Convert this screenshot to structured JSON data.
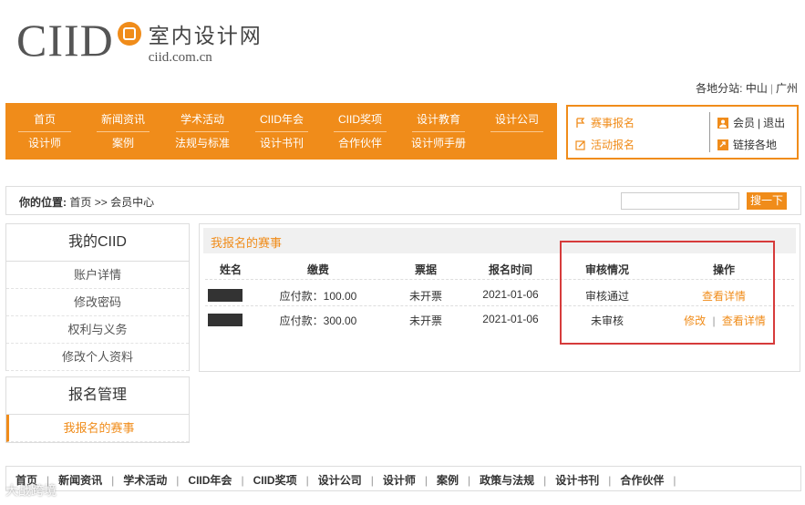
{
  "logo": {
    "brand": "CIID",
    "cn": "室内设计网",
    "en": "ciid.com.cn"
  },
  "branches": {
    "label": "各地分站:",
    "items": [
      "中山",
      "广州"
    ]
  },
  "nav": {
    "row1": [
      "首页",
      "新闻资讯",
      "学术活动",
      "CIID年会",
      "CIID奖项",
      "设计教育",
      "设计公司"
    ],
    "row2": [
      "设计师",
      "案例",
      "法规与标准",
      "设计书刊",
      "合作伙伴",
      "设计师手册"
    ]
  },
  "side_links": {
    "competition": "赛事报名",
    "activity": "活动报名",
    "member": "会员",
    "logout": "退出",
    "branches": "链接各地"
  },
  "location": {
    "label": "你的位置:",
    "home": "首页",
    "sep": ">>",
    "current": "会员中心"
  },
  "search": {
    "button": "搜一下",
    "value": ""
  },
  "sidebar": {
    "my_ciid": "我的CIID",
    "items": [
      "账户详情",
      "修改密码",
      "权利与义务",
      "修改个人资料"
    ],
    "reg_title": "报名管理",
    "reg_items": [
      "我报名的赛事"
    ]
  },
  "main": {
    "title": "我报名的赛事",
    "columns": [
      "姓名",
      "缴费",
      "票据",
      "报名时间",
      "审核情况",
      "操作"
    ],
    "rows": [
      {
        "fee": "应付款：100.00",
        "invoice": "未开票",
        "date": "2021-01-06",
        "status": "审核通过",
        "actions": [
          "查看详情"
        ]
      },
      {
        "fee": "应付款：300.00",
        "invoice": "未开票",
        "date": "2021-01-06",
        "status": "未审核",
        "actions": [
          "修改",
          "查看详情"
        ]
      }
    ]
  },
  "footer": [
    "首页",
    "新闻资讯",
    "学术活动",
    "CIID年会",
    "CIID奖项",
    "设计公司",
    "设计师",
    "案例",
    "政策与法规",
    "设计书刊",
    "合作伙伴"
  ],
  "watermark": "大战跨境",
  "colors": {
    "accent": "#f08c1a",
    "highlight_box": "#d63b3b"
  }
}
